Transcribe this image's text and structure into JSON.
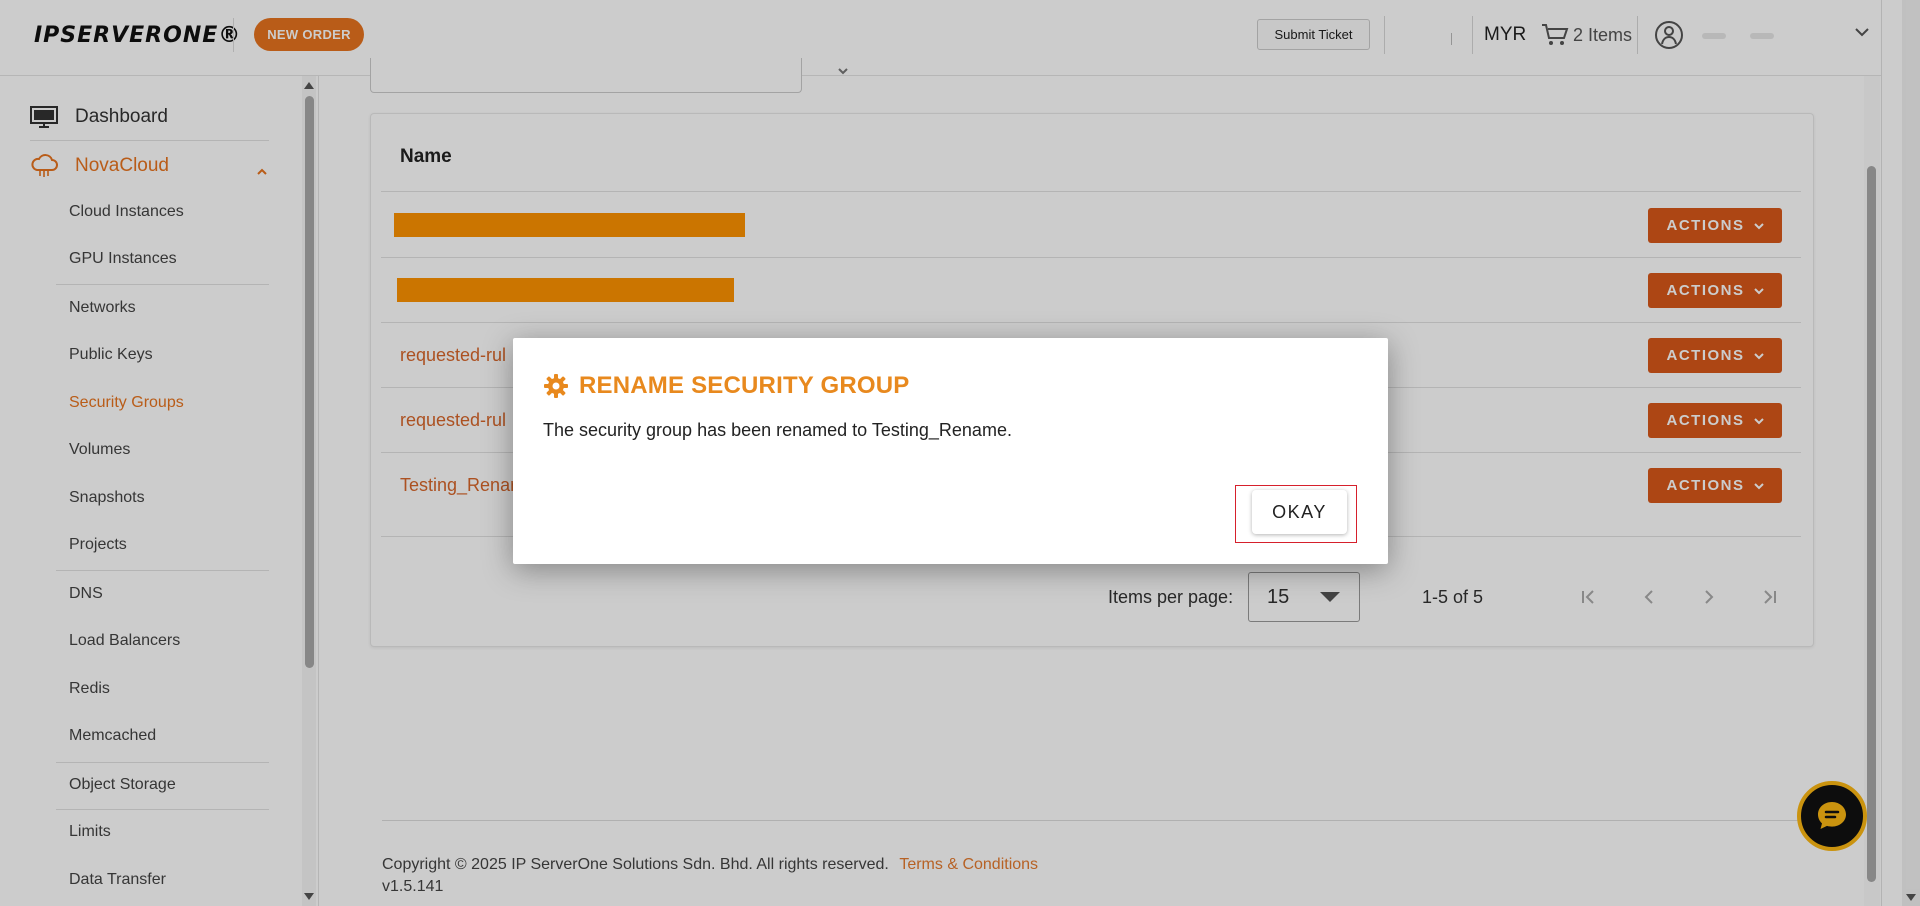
{
  "header": {
    "logo": "IPSERVERONE®",
    "new_order": "NEW ORDER",
    "submit_ticket": "Submit Ticket",
    "currency": "MYR",
    "cart": "2 Items"
  },
  "sidebar": {
    "dashboard": "Dashboard",
    "section": "NovaCloud",
    "items": [
      {
        "label": "Cloud Instances"
      },
      {
        "label": "GPU Instances"
      },
      {
        "label": "Networks"
      },
      {
        "label": "Public Keys"
      },
      {
        "label": "Security Groups"
      },
      {
        "label": "Volumes"
      },
      {
        "label": "Snapshots"
      },
      {
        "label": "Projects"
      },
      {
        "label": "DNS"
      },
      {
        "label": "Load Balancers"
      },
      {
        "label": "Redis"
      },
      {
        "label": "Memcached"
      },
      {
        "label": "Object Storage"
      },
      {
        "label": "Limits"
      },
      {
        "label": "Data Transfer"
      }
    ],
    "active_item": "Security Groups"
  },
  "table": {
    "header_name": "Name",
    "rows": [
      {
        "name": "",
        "redacted": true,
        "action": "ACTIONS"
      },
      {
        "name": "",
        "redacted": true,
        "action": "ACTIONS"
      },
      {
        "name": "requested-rul",
        "redacted": false,
        "action": "ACTIONS"
      },
      {
        "name": "requested-rul",
        "redacted": false,
        "action": "ACTIONS"
      },
      {
        "name": "Testing_Renar",
        "redacted": false,
        "action": "ACTIONS"
      }
    ]
  },
  "pager": {
    "label": "Items per page:",
    "per_page": "15",
    "range": "1-5 of 5"
  },
  "footer": {
    "copyright": "Copyright © 2025 IP ServerOne Solutions Sdn. Bhd. All rights reserved.",
    "terms": "Terms & Conditions",
    "version": "v1.5.141"
  },
  "modal": {
    "title": "RENAME SECURITY GROUP",
    "message": "The security group has been renamed to Testing_Rename.",
    "okay": "OKAY"
  },
  "colors": {
    "accent": "#e8741e",
    "action": "#d9581a",
    "redaction": "#fe9300",
    "modal_title": "#e8891e",
    "highlight_box": "#d6202c"
  }
}
